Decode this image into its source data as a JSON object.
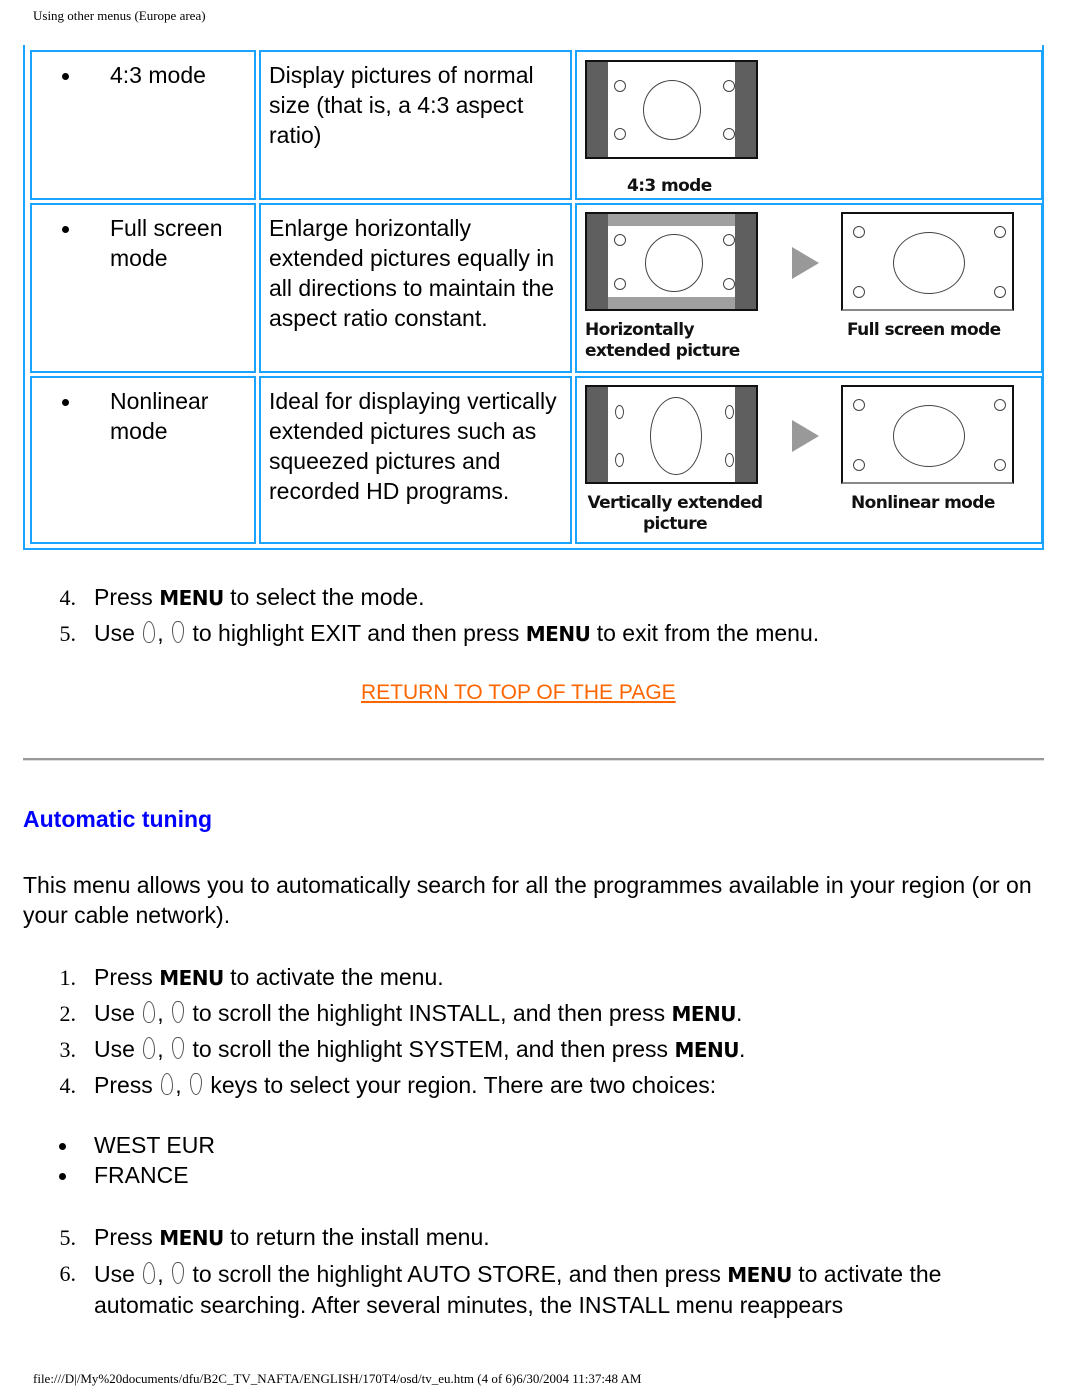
{
  "page_header": "Using other menus (Europe area)",
  "modes": [
    {
      "name": "4:3 mode",
      "description": "Display pictures of normal size (that is, a 4:3 aspect ratio)",
      "illustration": {
        "source_caption": "4:3 mode",
        "target_caption": null
      }
    },
    {
      "name": "Full screen mode",
      "description": "Enlarge horizontally extended pictures equally in all directions to maintain the aspect ratio constant.",
      "illustration": {
        "source_caption": "Horizontally extended picture",
        "target_caption": "Full screen mode"
      }
    },
    {
      "name": "Nonlinear mode",
      "description": "Ideal for displaying vertically extended pictures such as squeezed pictures and recorded HD programs.",
      "illustration": {
        "source_caption": "Vertically extended picture",
        "target_caption": "Nonlinear mode"
      }
    }
  ],
  "mode_steps": [
    {
      "num": "4.",
      "pre": "Press",
      "key": "MENU",
      "post": "to select the mode."
    },
    {
      "num": "5.",
      "pre": "Use",
      "key_after": "MENU",
      "mid": "to highlight EXIT and then press",
      "post": "to exit from the menu."
    }
  ],
  "return_link": "RETURN TO TOP OF THE PAGE",
  "section": {
    "title": "Automatic tuning",
    "intro": "This menu allows you to automatically search for all the programmes available in your region (or on your cable network).",
    "steps": [
      {
        "num": "1.",
        "pre": "Press",
        "key": "MENU",
        "post": "to activate the menu."
      },
      {
        "num": "2.",
        "pre": "Use",
        "mid": "to scroll the highlight INSTALL, and then press",
        "key": "MENU",
        "post": "."
      },
      {
        "num": "3.",
        "pre": "Use",
        "mid": "to scroll the highlight SYSTEM, and then press",
        "key": "MENU",
        "post": "."
      },
      {
        "num": "4.",
        "pre": "Press",
        "mid": "keys to select your region. There are two choices:"
      }
    ],
    "regions": [
      "WEST EUR",
      "FRANCE"
    ],
    "steps_after": [
      {
        "num": "5.",
        "pre": "Press",
        "key": "MENU",
        "post": "to return the install menu."
      },
      {
        "num": "6.",
        "pre": "Use",
        "mid": "to scroll the highlight AUTO STORE, and then press",
        "key": "MENU",
        "post": "to activate the automatic searching. After several minutes, the INSTALL menu reappears"
      }
    ]
  },
  "key_icons": {
    "up": "up-key-icon",
    "down": "down-key-icon",
    "separator": ","
  },
  "page_footer": "file:///D|/My%20documents/dfu/B2C_TV_NAFTA/ENGLISH/170T4/osd/tv_eu.htm (4 of 6)6/30/2004 11:37:48 AM"
}
